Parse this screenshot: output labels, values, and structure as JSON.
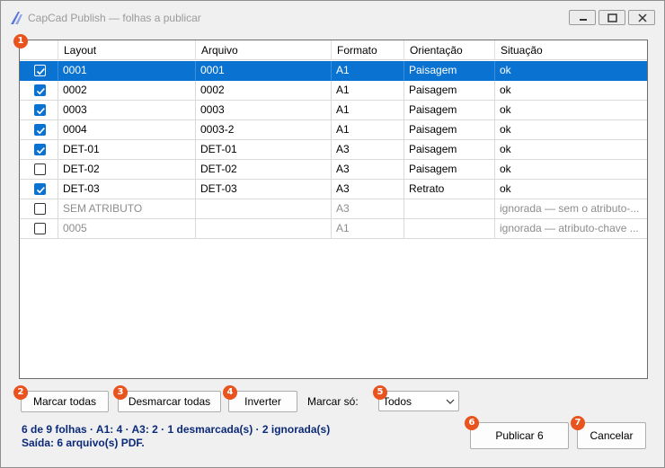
{
  "window": {
    "title": "CapCad Publish — folhas a publicar"
  },
  "grid": {
    "columns": [
      "Layout",
      "Arquivo",
      "Formato",
      "Orientação",
      "Situação"
    ],
    "rows": [
      {
        "checked": true,
        "layout": "0001",
        "arquivo": "0001",
        "formato": "A1",
        "orientacao": "Paisagem",
        "situacao": "ok",
        "selected": true,
        "ignored": false
      },
      {
        "checked": true,
        "layout": "0002",
        "arquivo": "0002",
        "formato": "A1",
        "orientacao": "Paisagem",
        "situacao": "ok",
        "selected": false,
        "ignored": false
      },
      {
        "checked": true,
        "layout": "0003",
        "arquivo": "0003",
        "formato": "A1",
        "orientacao": "Paisagem",
        "situacao": "ok",
        "selected": false,
        "ignored": false
      },
      {
        "checked": true,
        "layout": "0004",
        "arquivo": "0003-2",
        "formato": "A1",
        "orientacao": "Paisagem",
        "situacao": "ok",
        "selected": false,
        "ignored": false
      },
      {
        "checked": true,
        "layout": "DET-01",
        "arquivo": "DET-01",
        "formato": "A3",
        "orientacao": "Paisagem",
        "situacao": "ok",
        "selected": false,
        "ignored": false
      },
      {
        "checked": false,
        "layout": "DET-02",
        "arquivo": "DET-02",
        "formato": "A3",
        "orientacao": "Paisagem",
        "situacao": "ok",
        "selected": false,
        "ignored": false
      },
      {
        "checked": true,
        "layout": "DET-03",
        "arquivo": "DET-03",
        "formato": "A3",
        "orientacao": "Retrato",
        "situacao": "ok",
        "selected": false,
        "ignored": false
      },
      {
        "checked": false,
        "layout": "SEM ATRIBUTO",
        "arquivo": "",
        "formato": "A3",
        "orientacao": "",
        "situacao": "ignorada — sem o atributo-...",
        "selected": false,
        "ignored": true
      },
      {
        "checked": false,
        "layout": "0005",
        "arquivo": "",
        "formato": "A1",
        "orientacao": "",
        "situacao": "ignorada — atributo-chave ...",
        "selected": false,
        "ignored": true
      }
    ]
  },
  "toolbar": {
    "mark_all": "Marcar todas",
    "unmark_all": "Desmarcar todas",
    "invert": "Inverter",
    "mark_only_label": "Marcar só:",
    "mark_only_value": "Todos"
  },
  "status": {
    "line1": "6 de 9 folhas · A1: 4 · A3: 2 · 1 desmarcada(s) · 2 ignorada(s)",
    "line2": "Saída: 6 arquivo(s) PDF."
  },
  "actions": {
    "publish": "Publicar 6",
    "cancel": "Cancelar"
  },
  "badges": [
    "1",
    "2",
    "3",
    "4",
    "5",
    "6",
    "7"
  ],
  "colors": {
    "selection": "#0a73d1",
    "badge": "#e8531e",
    "status_text": "#0b2a7a"
  }
}
